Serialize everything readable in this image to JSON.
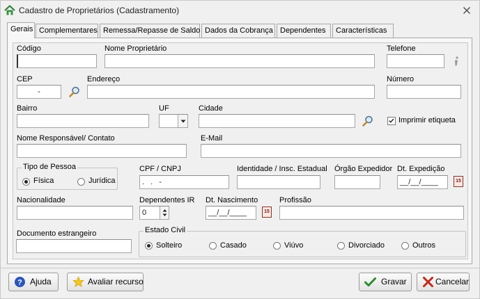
{
  "window": {
    "title": "Cadastro de Proprietários (Cadastramento)"
  },
  "tabs": [
    {
      "label": "Gerais",
      "active": true
    },
    {
      "label": "Complementares"
    },
    {
      "label": "Remessa/Repasse de Saldo"
    },
    {
      "label": "Dados da Cobrança"
    },
    {
      "label": "Dependentes"
    },
    {
      "label": "Características"
    }
  ],
  "form": {
    "codigo": {
      "label": "Código",
      "value": ""
    },
    "nome": {
      "label": "Nome Proprietário",
      "value": ""
    },
    "telefone": {
      "label": "Telefone",
      "value": ""
    },
    "cep": {
      "label": "CEP",
      "value": "-"
    },
    "endereco": {
      "label": "Endereço",
      "value": ""
    },
    "numero": {
      "label": "Número",
      "value": ""
    },
    "bairro": {
      "label": "Bairro",
      "value": ""
    },
    "uf": {
      "label": "UF",
      "value": ""
    },
    "cidade": {
      "label": "Cidade",
      "value": ""
    },
    "imprimir_etiqueta": {
      "label": "Imprimir etiqueta",
      "checked": true
    },
    "responsavel": {
      "label": "Nome Responsável/ Contato",
      "value": ""
    },
    "email": {
      "label": "E-Mail",
      "value": ""
    },
    "tipo_pessoa": {
      "label": "Tipo de Pessoa",
      "options": [
        "Física",
        "Jurídica"
      ],
      "selected": "Física"
    },
    "cpf_cnpj": {
      "label": "CPF / CNPJ",
      "value": ". . -"
    },
    "identidade": {
      "label": "Identidade / Insc. Estadual",
      "value": ""
    },
    "orgao_expedidor": {
      "label": "Órgão Expedidor",
      "value": ""
    },
    "dt_expedicao": {
      "label": "Dt. Expedição",
      "value": "__/__/____"
    },
    "nacionalidade": {
      "label": "Nacionalidade",
      "value": ""
    },
    "dependentes_ir": {
      "label": "Dependentes IR",
      "value": "0"
    },
    "dt_nascimento": {
      "label": "Dt. Nascimento",
      "value": "__/__/____"
    },
    "profissao": {
      "label": "Profissão",
      "value": ""
    },
    "documento_estrangeiro": {
      "label": "Documento estrangeiro",
      "value": ""
    },
    "estado_civil": {
      "label": "Estado Civil",
      "options": [
        "Solteiro",
        "Casado",
        "Viúvo",
        "Divorciado",
        "Outros"
      ],
      "selected": "Solteiro"
    },
    "calendar_glyph": "15"
  },
  "buttons": {
    "ajuda": "Ajuda",
    "avaliar": "Avaliar recurso",
    "gravar": "Gravar",
    "cancelar": "Cancelar"
  },
  "icons": {
    "title": "home-icon",
    "search": "magnifier-icon",
    "info": "info-icon",
    "calendar": "calendar-icon"
  },
  "colors": {
    "background": "#f0f0f0",
    "window_border": "#c8c8c8",
    "accent_green": "#2e8b2e",
    "accent_red": "#c0281c",
    "help_blue": "#2a55b8"
  }
}
